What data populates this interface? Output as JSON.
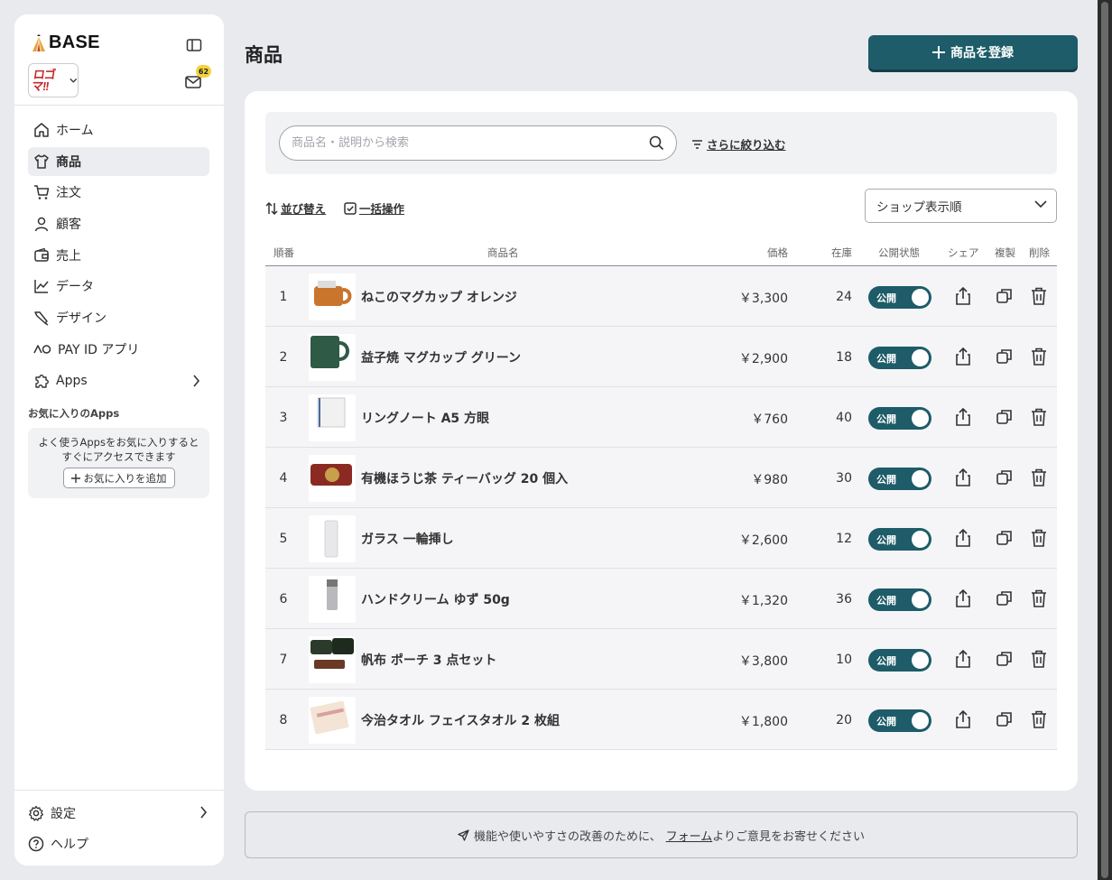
{
  "brand": {
    "name": "BASE"
  },
  "shop": {
    "logo_text": "ロゴマ!!"
  },
  "mail": {
    "badge_count": "62"
  },
  "nav": {
    "items": [
      {
        "label": "ホーム",
        "icon": "home-icon"
      },
      {
        "label": "商品",
        "icon": "shirt-icon",
        "active": true
      },
      {
        "label": "注文",
        "icon": "cart-icon"
      },
      {
        "label": "顧客",
        "icon": "user-icon"
      },
      {
        "label": "売上",
        "icon": "wallet-icon"
      },
      {
        "label": "データ",
        "icon": "chart-line-icon"
      },
      {
        "label": "デザイン",
        "icon": "brush-icon"
      },
      {
        "label": "PAY ID アプリ",
        "icon": "payid-icon"
      },
      {
        "label": "Apps",
        "icon": "puzzle-icon"
      }
    ]
  },
  "favorites": {
    "title": "お気に入りのApps",
    "description": "よく使うAppsをお気に入りするとすぐにアクセスできます",
    "add_label": "お気に入りを追加"
  },
  "bottom_nav": {
    "settings": "設定",
    "help": "ヘルプ"
  },
  "page": {
    "title": "商品",
    "register_label": "商品を登録"
  },
  "search": {
    "placeholder": "商品名・説明から検索",
    "value": ""
  },
  "filters": {
    "refine_label": "さらに絞り込む",
    "sort_label": "並び替え",
    "bulk_label": "一括操作"
  },
  "sort_select": {
    "selected": "ショップ表示順"
  },
  "table": {
    "headers": {
      "order": "順番",
      "name": "商品名",
      "price": "価格",
      "stock": "在庫",
      "status": "公開状態",
      "share": "シェア",
      "copy": "複製",
      "delete": "削除"
    },
    "rows": [
      {
        "order": "1",
        "name": "ねこのマグカップ オレンジ",
        "price": "￥3,300",
        "stock": "24",
        "status": "公開"
      },
      {
        "order": "2",
        "name": "益子焼 マグカップ グリーン",
        "price": "￥2,900",
        "stock": "18",
        "status": "公開"
      },
      {
        "order": "3",
        "name": "リングノート A5 方眼",
        "price": "￥760",
        "stock": "40",
        "status": "公開"
      },
      {
        "order": "4",
        "name": "有機ほうじ茶 ティーバッグ 20 個入",
        "price": "￥980",
        "stock": "30",
        "status": "公開"
      },
      {
        "order": "5",
        "name": "ガラス 一輪挿し",
        "price": "￥2,600",
        "stock": "12",
        "status": "公開"
      },
      {
        "order": "6",
        "name": "ハンドクリーム ゆず 50g",
        "price": "￥1,320",
        "stock": "36",
        "status": "公開"
      },
      {
        "order": "7",
        "name": "帆布 ポーチ 3 点セット",
        "price": "￥3,800",
        "stock": "10",
        "status": "公開"
      },
      {
        "order": "8",
        "name": "今治タオル フェイスタオル 2 枚組",
        "price": "￥1,800",
        "stock": "20",
        "status": "公開"
      }
    ]
  },
  "feedback": {
    "prefix": "機能や使いやすさの改善のために、",
    "link": "フォーム",
    "suffix": "よりご意見をお寄せください"
  },
  "colors": {
    "accent": "#1d5c68",
    "badge": "#f3d33c",
    "background": "#e9eaee"
  }
}
